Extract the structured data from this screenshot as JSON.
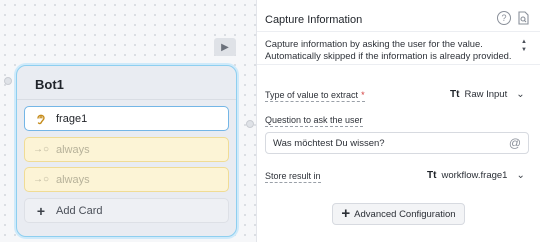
{
  "canvas": {
    "play_icon": "play-icon"
  },
  "bot_node": {
    "title": "Bot1",
    "cards": [
      {
        "label": "frage1",
        "icon": "ear-icon"
      },
      {
        "label": "always",
        "icon": "arrow-circle-icon"
      },
      {
        "label": "always",
        "icon": "arrow-circle-icon"
      }
    ],
    "add_card_label": "Add Card"
  },
  "panel": {
    "title": "Capture Information",
    "help_icon": "?",
    "description": "Capture information by asking the user for the value. Automatically skipped if the information is already provided.",
    "type_label": "Type of value to extract",
    "type_required": "*",
    "type_value": "Raw Input",
    "type_icon_text": "Tt",
    "question_label": "Question to ask the user",
    "question_value": "Was möchtest Du wissen?",
    "store_label": "Store result in",
    "store_value": "workflow.frage1",
    "store_icon_text": "Tt",
    "advanced_button": "Advanced Configuration"
  }
}
